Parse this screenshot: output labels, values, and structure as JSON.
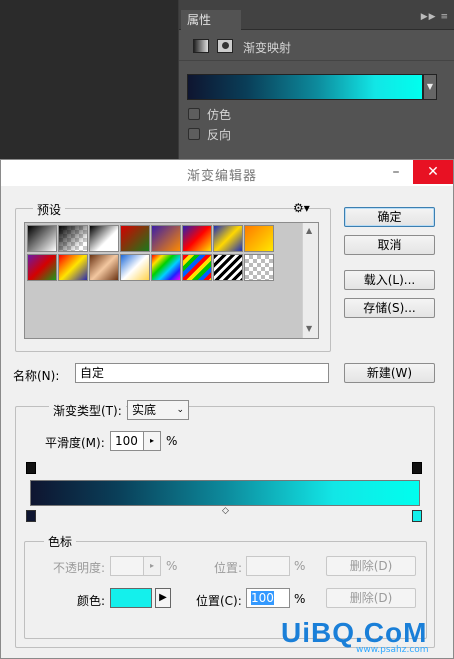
{
  "properties_panel": {
    "tab_label": "属性",
    "adjustment_title": "渐变映射",
    "dither_label": "仿色",
    "reverse_label": "反向"
  },
  "dialog": {
    "title": "渐变编辑器",
    "presets_label": "预设",
    "buttons": {
      "ok": "确定",
      "cancel": "取消",
      "load": "载入(L)...",
      "save": "存储(S)...",
      "new": "新建(W)"
    },
    "name_label": "名称(N):",
    "name_value": "自定",
    "gradient_type_label": "渐变类型(T):",
    "gradient_type_value": "实底",
    "smoothness_label": "平滑度(M):",
    "smoothness_value": "100",
    "percent": "%",
    "color_stops_group": "色标",
    "opacity_label": "不透明度:",
    "opacity_location_label": "位置:",
    "opacity_delete": "删除(D)",
    "color_label": "颜色:",
    "color_location_label": "位置(C):",
    "color_location_value": "100",
    "color_delete": "删除(D)",
    "stop_color": "#14f0ec",
    "gradient_start_color": "#0e1530",
    "gradient_end_color": "#00ffee"
  },
  "watermark": {
    "text": "UiBQ.CoM",
    "sub": "www.psahz.com"
  }
}
